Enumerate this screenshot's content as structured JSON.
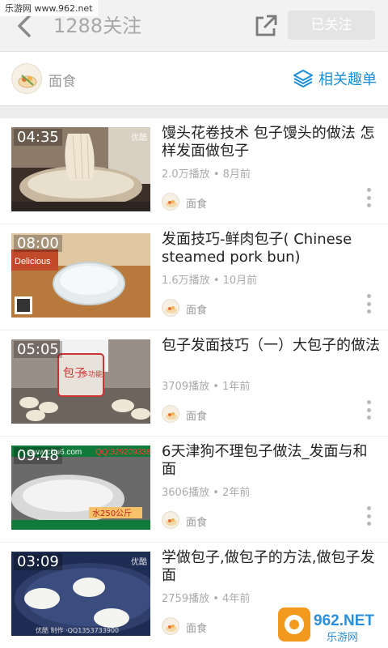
{
  "watermark": {
    "top_text": "乐游网 www.962.net",
    "logo_text": "962.NET",
    "logo_sub": "乐游网"
  },
  "header": {
    "title": "1288关注",
    "follow_label": "已关注"
  },
  "topic": {
    "label": "面食",
    "related_label": "相关趣单"
  },
  "colors": {
    "accent": "#1e8fd6",
    "header_bg": "#f2f2f2",
    "follow_bg": "#e4e4e4"
  },
  "items": [
    {
      "duration": "04:35",
      "brand": "优酷",
      "title": "馒头花卷技术 包子馒头的做法 怎样发面做包子",
      "plays": "2.0万播放",
      "age": "8月前",
      "tag": "面食"
    },
    {
      "duration": "08:00",
      "brand": "",
      "title": "发面技巧-鲜肉包子( Chinese steamed pork bun)",
      "plays": "1.6万播放",
      "age": "10月前",
      "tag": "面食"
    },
    {
      "duration": "05:05",
      "brand": "",
      "title": "包子发面技巧（一）大包子的做法",
      "plays": "3709播放",
      "age": "1年前",
      "tag": "面食"
    },
    {
      "duration": "09:48",
      "brand": "",
      "title": "6天津狗不理包子做法_发面与和面",
      "plays": "3606播放",
      "age": "2年前",
      "tag": "面食"
    },
    {
      "duration": "03:09",
      "brand": "优酷",
      "title": "学做包子,做包子的方法,做包子发面",
      "plays": "2759播放",
      "age": "4年前",
      "tag": "面食"
    }
  ],
  "thumb_overlays": {
    "t2_brand": "Delicious",
    "t3_bag": "包子",
    "t3_bag2": "多功能",
    "t4_site": "www.chu6.com",
    "t4_qq": "QQ:329209338",
    "t4_label": "水250公斤",
    "t5_caption": "优酷 制作 ·QQ1353733900"
  },
  "separator": "•"
}
